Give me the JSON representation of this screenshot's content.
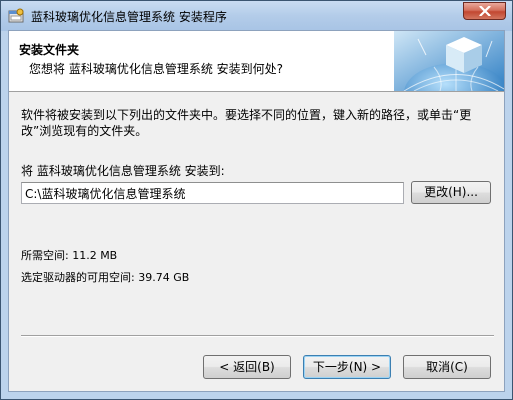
{
  "window": {
    "title": "蓝科玻璃优化信息管理系统 安装程序"
  },
  "header": {
    "title": "安装文件夹",
    "subtitle": "您想将 蓝科玻璃优化信息管理系统 安装到何处?"
  },
  "body": {
    "description": "软件将被安装到以下列出的文件夹中。要选择不同的位置，键入新的路径，或单击“更改”浏览现有的文件夹。",
    "install_label": "将 蓝科玻璃优化信息管理系统 安装到:",
    "install_path": "C:\\蓝科玻璃优化信息管理系统",
    "browse_label": "更改(H)...",
    "space_required": "所需空间: 11.2 MB",
    "space_available": "选定驱动器的可用空间: 39.74 GB"
  },
  "footer": {
    "back_label": "< 返回(B)",
    "next_label": "下一步(N) >",
    "cancel_label": "取消(C)"
  },
  "icons": {
    "app": "installer-app-icon",
    "close": "close-icon",
    "header_graphic": "globe-cube-graphic"
  },
  "colors": {
    "titlebar": "#b3cce9",
    "close_button": "#c24832",
    "dialog_background": "#f0f0f0",
    "default_button_border": "#3c7fb1"
  }
}
